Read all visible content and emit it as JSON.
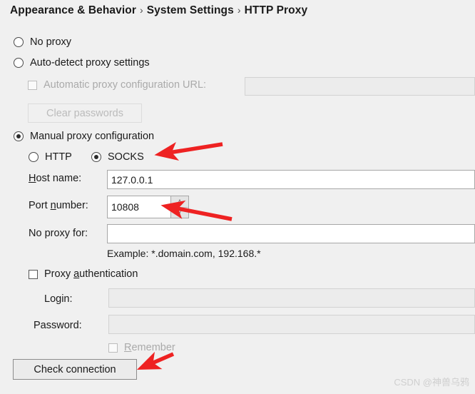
{
  "breadcrumb": {
    "items": [
      "Appearance & Behavior",
      "System Settings",
      "HTTP Proxy"
    ],
    "separator": "›"
  },
  "options": {
    "no_proxy": {
      "label": "No proxy",
      "selected": false
    },
    "auto_detect": {
      "label": "Auto-detect proxy settings",
      "selected": false
    },
    "manual": {
      "label": "Manual proxy configuration",
      "selected": true
    },
    "http": {
      "label": "HTTP",
      "selected": false
    },
    "socks": {
      "label": "SOCKS",
      "selected": true
    }
  },
  "auto_config": {
    "checkbox_label": "Automatic proxy configuration URL:",
    "checked": false,
    "url_value": "",
    "clear_passwords_label": "Clear passwords"
  },
  "manual_fields": {
    "host_label_pre": "H",
    "host_label_post": "ost name:",
    "host_value": "127.0.0.1",
    "port_label_pre": "Port ",
    "port_label_mid": "n",
    "port_label_post": "umber:",
    "port_value": "10808",
    "spinner_up": "˄",
    "spinner_down": "˅",
    "no_proxy_for_label": "No proxy for:",
    "no_proxy_for_value": "",
    "example_text": "Example: *.domain.com, 192.168.*"
  },
  "authentication": {
    "checkbox_label_pre": "Proxy ",
    "checkbox_label_mid": "a",
    "checkbox_label_post": "uthentication",
    "checked": false,
    "login_label": "Login:",
    "login_value": "",
    "password_label": "Password:",
    "password_value": "",
    "remember_label_pre": "R",
    "remember_label_post": "emember",
    "remember_checked": false
  },
  "actions": {
    "check_connection_label": "Check connection"
  },
  "annotations": {
    "arrow_color": "#ee2222",
    "arrow_socks": "points at SOCKS radio button",
    "arrow_port": "points at port number field",
    "arrow_check_connection": "points at Check connection button"
  },
  "watermark": {
    "text": "CSDN @神兽乌鸦"
  }
}
